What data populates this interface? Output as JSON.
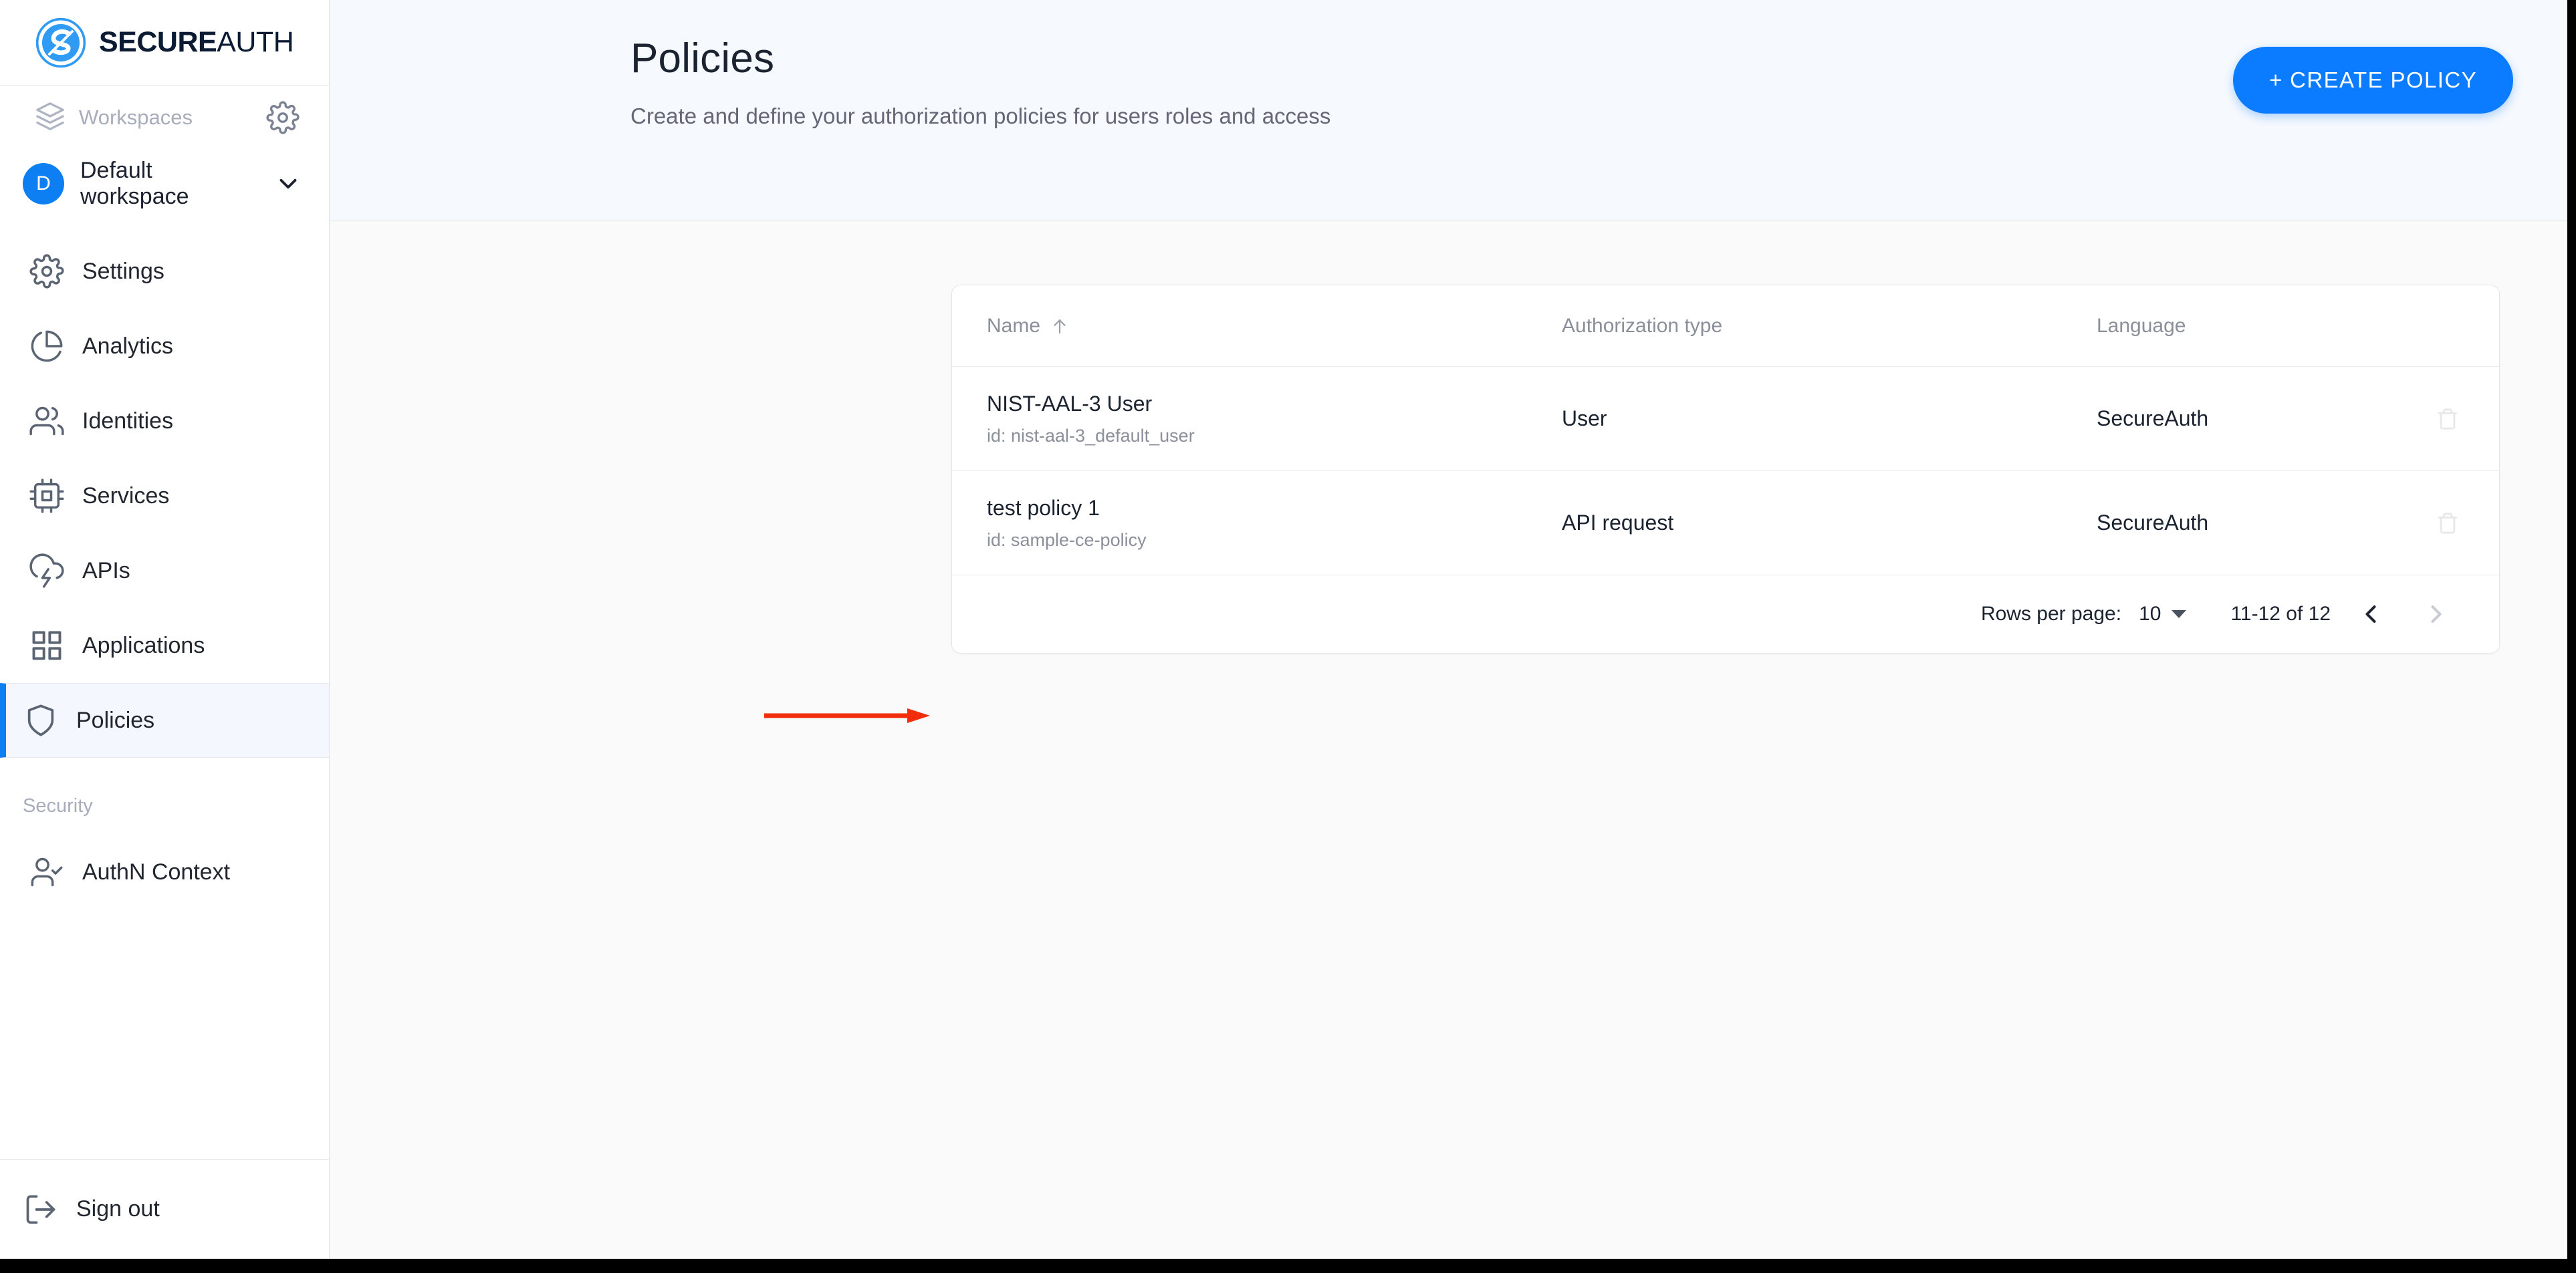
{
  "brand": {
    "name_bold": "SECURE",
    "name_light": "AUTH",
    "logo_icon": "secureauth-logo-icon",
    "accent": "#0d7ff2"
  },
  "sidebar": {
    "workspaces_label": "Workspaces",
    "workspaces_icon": "layers-icon",
    "settings_gear_icon": "gear-icon",
    "workspace": {
      "initial": "D",
      "name": "Default workspace",
      "chevron_icon": "chevron-down-icon"
    },
    "items": [
      {
        "label": "Settings",
        "icon": "gear-icon",
        "active": false
      },
      {
        "label": "Analytics",
        "icon": "pie-chart-icon",
        "active": false
      },
      {
        "label": "Identities",
        "icon": "users-icon",
        "active": false
      },
      {
        "label": "Services",
        "icon": "chip-icon",
        "active": false
      },
      {
        "label": "APIs",
        "icon": "cloud-bolt-icon",
        "active": false
      },
      {
        "label": "Applications",
        "icon": "grid-icon",
        "active": false
      },
      {
        "label": "Policies",
        "icon": "shield-icon",
        "active": true
      }
    ],
    "section_label": "Security",
    "security_items": [
      {
        "label": "AuthN Context",
        "icon": "user-check-icon"
      }
    ],
    "signout": {
      "label": "Sign out",
      "icon": "sign-out-icon"
    }
  },
  "header": {
    "title": "Policies",
    "subtitle": "Create and define your authorization policies for users roles and access",
    "create_button": "+ CREATE POLICY",
    "create_button_color": "#0b7bff"
  },
  "table": {
    "columns": [
      {
        "label": "Name",
        "sort": "asc",
        "sort_icon": "arrow-up-icon"
      },
      {
        "label": "Authorization type"
      },
      {
        "label": "Language"
      }
    ],
    "rows": [
      {
        "name": "NIST-AAL-3 User",
        "id": "id: nist-aal-3_default_user",
        "auth_type": "User",
        "language": "SecureAuth",
        "delete_icon": "trash-icon"
      },
      {
        "name": "test policy 1",
        "id": "id: sample-ce-policy",
        "auth_type": "API request",
        "language": "SecureAuth",
        "delete_icon": "trash-icon"
      }
    ],
    "footer": {
      "rows_per_page_label": "Rows per page:",
      "rows_per_page_value": "10",
      "range": "11-12 of 12",
      "prev_icon": "chevron-left-icon",
      "next_icon": "chevron-right-icon"
    }
  },
  "annotation": {
    "type": "arrow-right",
    "color": "#f22d0c"
  }
}
